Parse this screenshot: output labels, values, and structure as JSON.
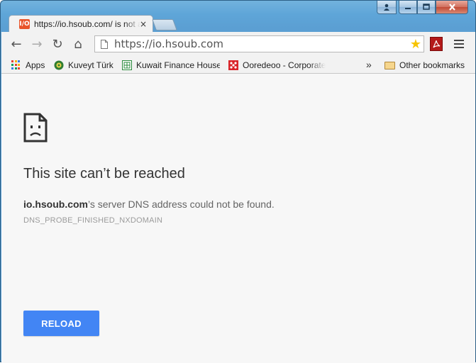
{
  "window": {
    "controls": {
      "user": "user-icon",
      "minimize": "minimize-icon",
      "maximize": "maximize-icon",
      "close": "close-icon"
    }
  },
  "tab": {
    "favicon_text": "I/O",
    "title": "https://io.hsoub.com/ is not available",
    "close_glyph": "×"
  },
  "toolbar": {
    "back": "←",
    "forward": "→",
    "reload": "↻",
    "home": "⌂",
    "url": "https://io.hsoub.com",
    "star": "★"
  },
  "bookmarks": {
    "items": [
      {
        "label": "Apps",
        "icon": "apps-grid-icon"
      },
      {
        "label": "Kuveyt Türk",
        "icon": "kuveyt-turk-icon"
      },
      {
        "label": "Kuwait Finance House",
        "icon": "kfh-icon"
      },
      {
        "label": "Ooredeoo - Corporate",
        "icon": "ooredoo-icon"
      }
    ],
    "overflow": "»",
    "other": "Other bookmarks"
  },
  "error": {
    "title": "This site can’t be reached",
    "host": "io.hsoub.com",
    "message": "’s server DNS address could not be found.",
    "code": "DNS_PROBE_FINISHED_NXDOMAIN",
    "reload_label": "RELOAD"
  },
  "colors": {
    "accent": "#4285f4",
    "frame": "#5ea5d8",
    "content_bg": "#f7f7f7"
  }
}
